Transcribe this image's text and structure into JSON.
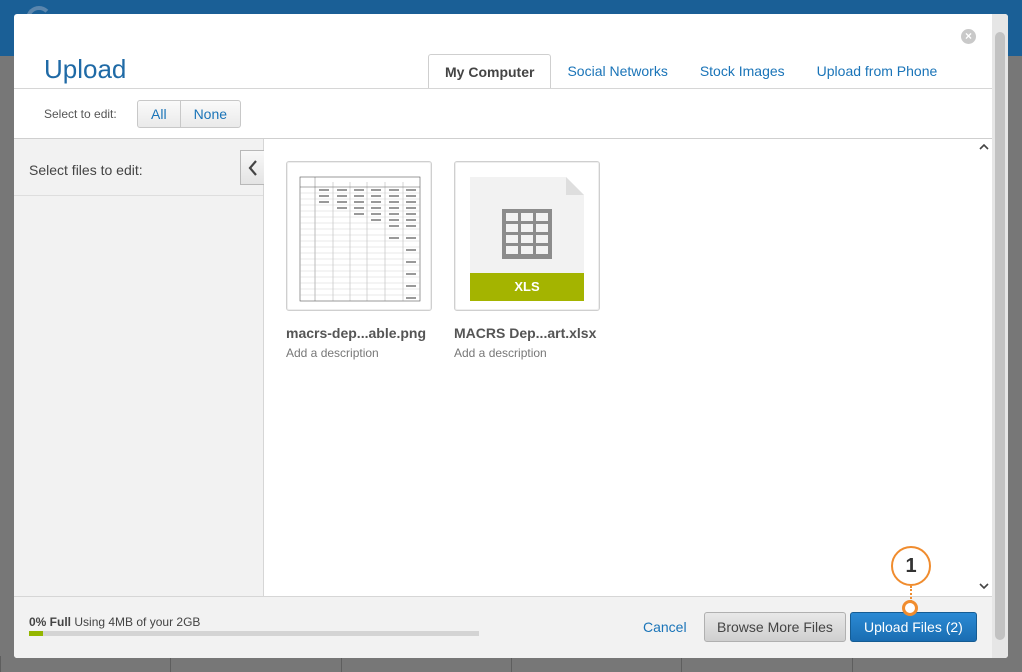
{
  "modal": {
    "title": "Upload",
    "close_glyph": "×",
    "tabs": [
      {
        "label": "My Computer",
        "active": true
      },
      {
        "label": "Social Networks",
        "active": false
      },
      {
        "label": "Stock Images",
        "active": false
      },
      {
        "label": "Upload from Phone",
        "active": false
      }
    ]
  },
  "toolbar": {
    "select_label": "Select to edit:",
    "all_label": "All",
    "none_label": "None"
  },
  "sidebar": {
    "label": "Select files to edit:",
    "collapse_icon": "chevron-left-icon"
  },
  "files": [
    {
      "name": "macrs-dep...able.png",
      "description": "Add a description",
      "type": "image-thumbnail"
    },
    {
      "name": "MACRS Dep...art.xlsx",
      "description": "Add a description",
      "type": "xls",
      "badge": "XLS"
    }
  ],
  "footer": {
    "usage_percent_label": "0% Full",
    "usage_text": "Using 4MB of your 2GB",
    "usage_fraction": 0.03,
    "cancel_label": "Cancel",
    "browse_label": "Browse More Files",
    "upload_label": "Upload Files (2)"
  },
  "callout": {
    "number": "1"
  },
  "colors": {
    "accent_blue": "#1a74b8",
    "upload_button": "#1f77c4",
    "xls_green": "#a4b400",
    "usage_green": "#94b600",
    "callout_orange": "#f08c2e"
  }
}
